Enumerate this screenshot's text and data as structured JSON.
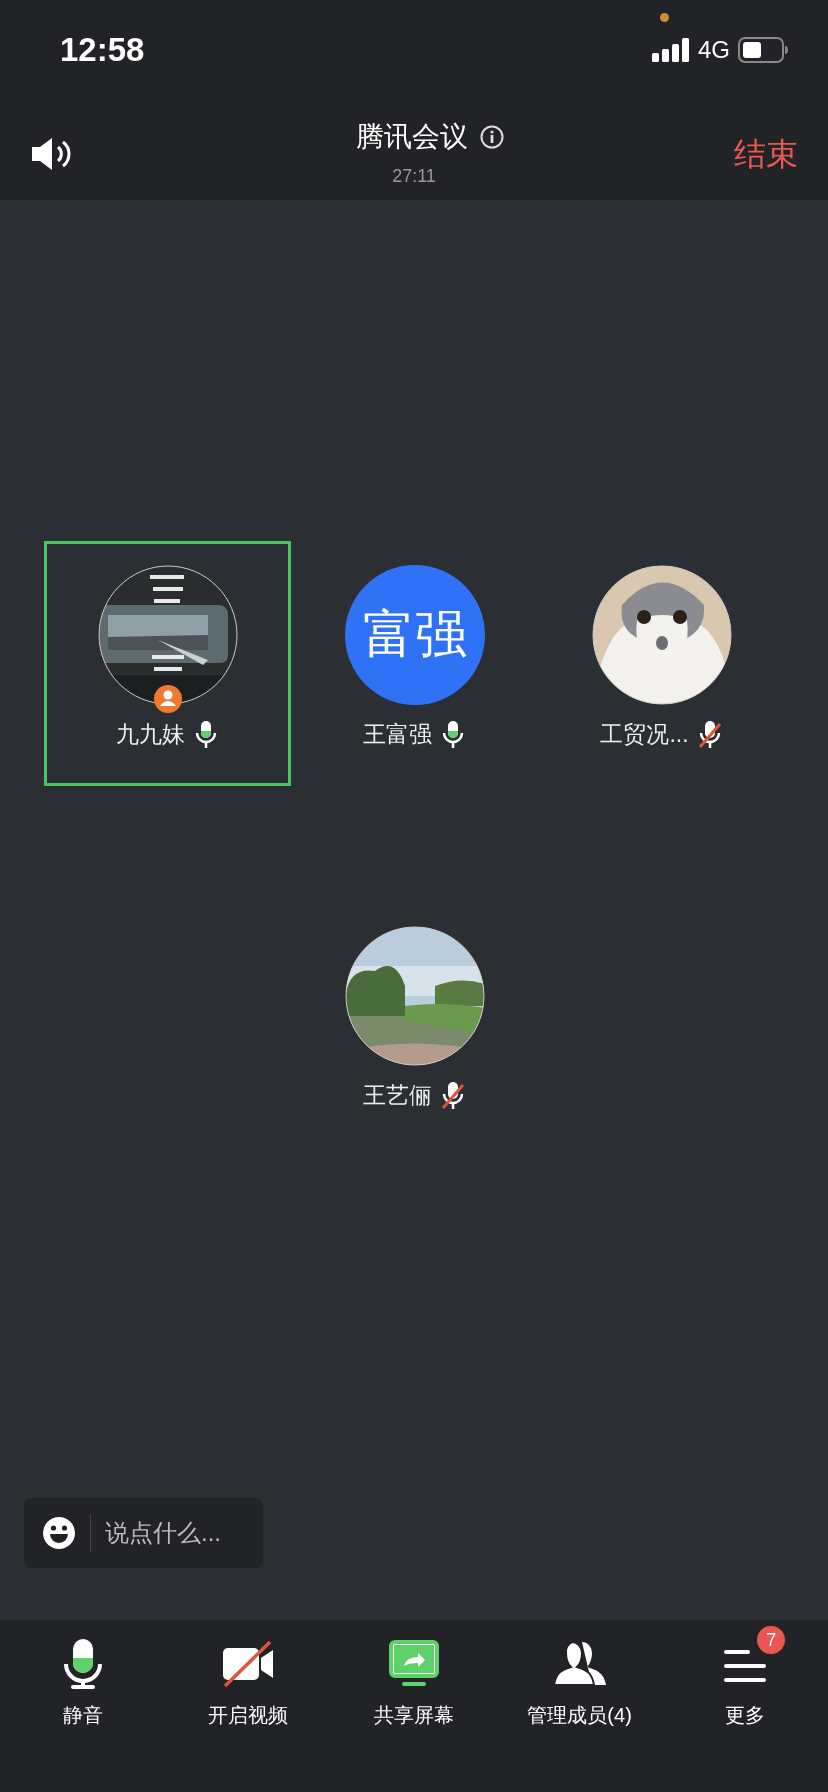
{
  "status_bar": {
    "time": "12:58",
    "network": "4G"
  },
  "header": {
    "title": "腾讯会议",
    "duration": "27:11",
    "end_button": "结束"
  },
  "participants": [
    {
      "name": "九九妹",
      "host": true,
      "selected": true,
      "muted": false
    },
    {
      "name": "王富强",
      "avatar": {
        "kind": "initials",
        "text": "富强"
      },
      "host": false,
      "selected": false,
      "muted": false
    },
    {
      "name": "工贸况...",
      "host": false,
      "selected": false,
      "muted": true
    },
    {
      "name": "王艺俪",
      "host": false,
      "selected": false,
      "muted": true
    }
  ],
  "chat": {
    "placeholder": "说点什么..."
  },
  "toolbar": [
    {
      "kind": "mic",
      "label": "静音"
    },
    {
      "kind": "video",
      "label": "开启视频"
    },
    {
      "kind": "share",
      "label": "共享屏幕"
    },
    {
      "kind": "members",
      "label": "管理成员(4)"
    },
    {
      "kind": "more",
      "label": "更多",
      "badge": "7"
    }
  ]
}
